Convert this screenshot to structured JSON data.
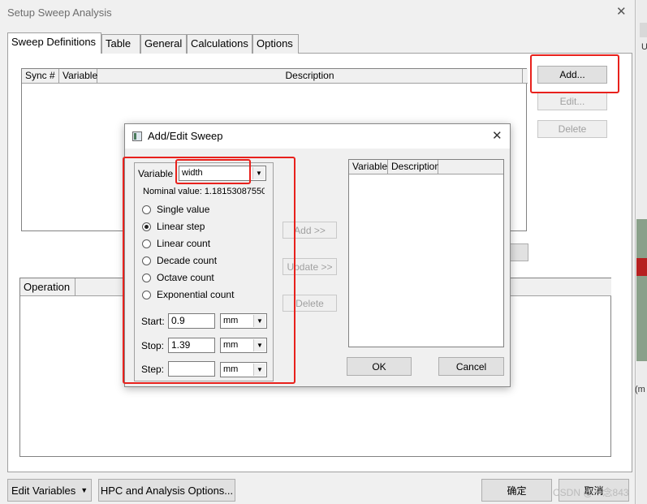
{
  "main_window": {
    "title": "Setup Sweep Analysis",
    "close_glyph": "✕",
    "tabs": [
      {
        "label": "Sweep Definitions"
      },
      {
        "label": "Table"
      },
      {
        "label": "General"
      },
      {
        "label": "Calculations"
      },
      {
        "label": "Options"
      }
    ],
    "sweep_table": {
      "columns": [
        "Sync #",
        "Variable",
        "Description"
      ]
    },
    "buttons": {
      "add": "Add...",
      "edit": "Edit...",
      "delete": "Delete"
    },
    "operation_table": {
      "columns": [
        "Operation"
      ]
    },
    "footer": {
      "edit_variables": "Edit Variables",
      "hpc_options": "HPC and Analysis Options...",
      "ok": "确定",
      "cancel": "取消"
    }
  },
  "dialog": {
    "title": "Add/Edit Sweep",
    "close_glyph": "✕",
    "variable_label": "Variable",
    "variable_value": "width",
    "nominal_value_text": "Nominal value:  1.18153087550",
    "sweep_types": [
      {
        "label": "Single value",
        "selected": false
      },
      {
        "label": "Linear step",
        "selected": true
      },
      {
        "label": "Linear count",
        "selected": false
      },
      {
        "label": "Decade count",
        "selected": false
      },
      {
        "label": "Octave count",
        "selected": false
      },
      {
        "label": "Exponential count",
        "selected": false
      }
    ],
    "start": {
      "label": "Start:",
      "value": "0.9",
      "unit": "mm"
    },
    "stop": {
      "label": "Stop:",
      "value": "1.39",
      "unit": "mm"
    },
    "step": {
      "label": "Step:",
      "value": "",
      "unit": "mm"
    },
    "middle_buttons": {
      "add": "Add >>",
      "update": "Update >>",
      "delete": "Delete"
    },
    "list_columns": [
      "Variable",
      "Description"
    ],
    "ok": "OK",
    "cancel": "Cancel"
  },
  "background": {
    "side_text_u": "U",
    "side_text_m": "(m",
    "watermark": "CSDN @一念843"
  },
  "colors": {
    "highlight": "#e8211c",
    "window_bg": "#f0f0f0"
  }
}
